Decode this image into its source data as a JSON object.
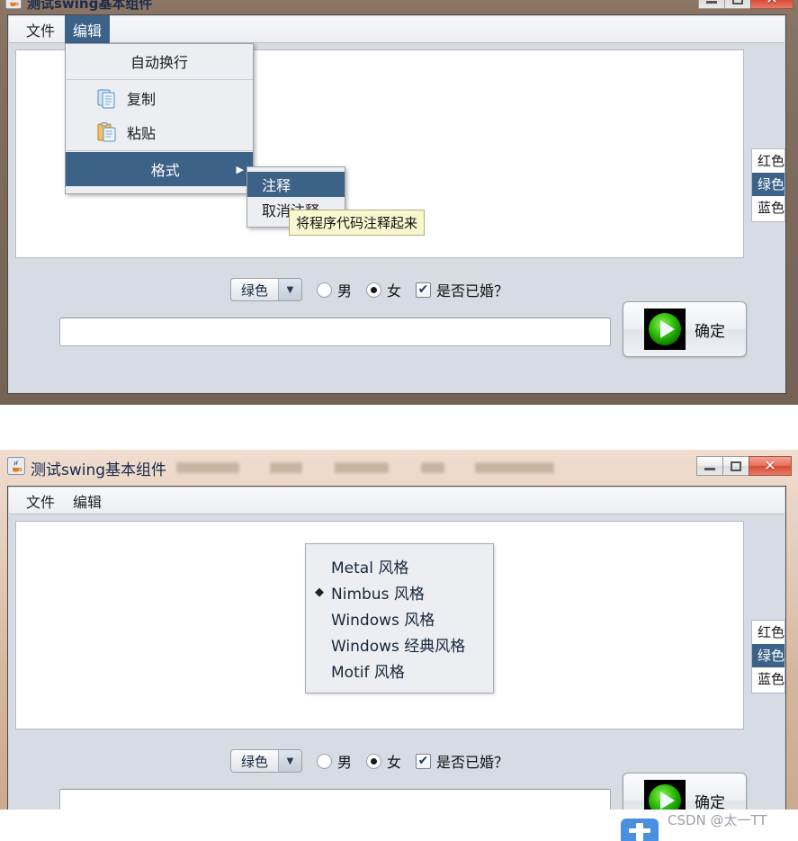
{
  "windows": [
    {
      "id": "window-top",
      "title": "测试swing基本组件",
      "app_icon": "java-coffee-cup-icon",
      "controls": {
        "minimize": "—",
        "maximize": "□",
        "close": "✕"
      },
      "menubar": [
        {
          "label": "文件",
          "active": false
        },
        {
          "label": "编辑",
          "active": true
        }
      ],
      "color_list": {
        "items": [
          {
            "label": "红色",
            "selected": false
          },
          {
            "label": "绿色",
            "selected": true
          },
          {
            "label": "蓝色",
            "selected": false
          }
        ]
      },
      "form": {
        "combo_value": "绿色",
        "combo_arrow": "▼",
        "radio_male": {
          "label": "男",
          "checked": false
        },
        "radio_female": {
          "label": "女",
          "checked": true
        },
        "checkbox_married": {
          "label": "是否已婚？",
          "checked": true,
          "glyph": "✔"
        }
      },
      "text_input": {
        "value": "",
        "placeholder": ""
      },
      "ok_button": {
        "label": "确定",
        "icon": "green-play-icon"
      },
      "edit_menu": {
        "items": [
          {
            "label": "自动换行",
            "icon": null,
            "selected": false,
            "submenu": false
          },
          {
            "label": "复制",
            "icon": "copy-icon",
            "selected": false,
            "submenu": false
          },
          {
            "label": "粘贴",
            "icon": "paste-icon",
            "selected": false,
            "submenu": false
          },
          {
            "label": "格式",
            "icon": null,
            "selected": true,
            "submenu": true,
            "arrow": "▶"
          }
        ]
      },
      "format_submenu": {
        "items": [
          {
            "label": "注释",
            "selected": true
          },
          {
            "label": "取消注释",
            "selected": false
          }
        ]
      },
      "tooltip": {
        "text": "将程序代码注释起来"
      }
    },
    {
      "id": "window-bottom",
      "title": "测试swing基本组件",
      "app_icon": "java-coffee-cup-icon",
      "controls": {
        "minimize": "—",
        "maximize": "□",
        "close": "✕"
      },
      "menubar": [
        {
          "label": "文件",
          "active": false
        },
        {
          "label": "编辑",
          "active": false
        }
      ],
      "color_list": {
        "items": [
          {
            "label": "红色",
            "selected": false
          },
          {
            "label": "绿色",
            "selected": true
          },
          {
            "label": "蓝色",
            "selected": false
          }
        ]
      },
      "form": {
        "combo_value": "绿色",
        "combo_arrow": "▼",
        "radio_male": {
          "label": "男",
          "checked": false
        },
        "radio_female": {
          "label": "女",
          "checked": true
        },
        "checkbox_married": {
          "label": "是否已婚？",
          "checked": true,
          "glyph": "✔"
        }
      },
      "text_input": {
        "value": "",
        "placeholder": ""
      },
      "ok_button": {
        "label": "确定",
        "icon": "green-play-icon"
      },
      "style_popup": {
        "marker": "◆",
        "items": [
          {
            "label": "Metal 风格",
            "selected": false
          },
          {
            "label": "Nimbus 风格",
            "selected": true
          },
          {
            "label": "Windows 风格",
            "selected": false
          },
          {
            "label": "Windows 经典风格",
            "selected": false
          },
          {
            "label": "Motif 风格",
            "selected": false
          }
        ]
      }
    }
  ],
  "watermark": {
    "text": "CSDN @太一TT"
  },
  "colors": {
    "menu_highlight": "#3c6288",
    "window_frame_top": "#7d6a5b",
    "window_frame_bottom": "#d4b69e",
    "panel_bg": "#d7dbe3",
    "tooltip_bg": "#f8f7cf",
    "close_button": "#d64b33",
    "play_icon_green": "#25c400"
  }
}
